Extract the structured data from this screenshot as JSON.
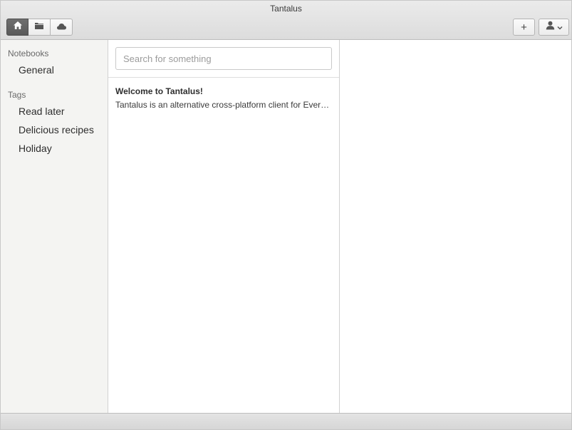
{
  "window": {
    "title": "Tantalus"
  },
  "toolbar": {
    "view_buttons": [
      {
        "icon": "home-icon",
        "active": true
      },
      {
        "icon": "folder-icon",
        "active": false
      },
      {
        "icon": "cloud-icon",
        "active": false
      }
    ],
    "add_label": "+",
    "account_icon": "user-icon"
  },
  "sidebar": {
    "notebooks_header": "Notebooks",
    "notebooks": [
      {
        "label": "General"
      }
    ],
    "tags_header": "Tags",
    "tags": [
      {
        "label": "Read later"
      },
      {
        "label": "Delicious recipes"
      },
      {
        "label": "Holiday"
      }
    ]
  },
  "search": {
    "placeholder": "Search for something",
    "value": ""
  },
  "notes": [
    {
      "title": "Welcome to Tantalus!",
      "snippet": "Tantalus is an alternative cross-platform client for Evernote"
    }
  ],
  "colors": {
    "active_button": "#5f5f5f",
    "sidebar_bg": "#f4f4f2",
    "titlebar_bg": "#e3e3e3"
  }
}
